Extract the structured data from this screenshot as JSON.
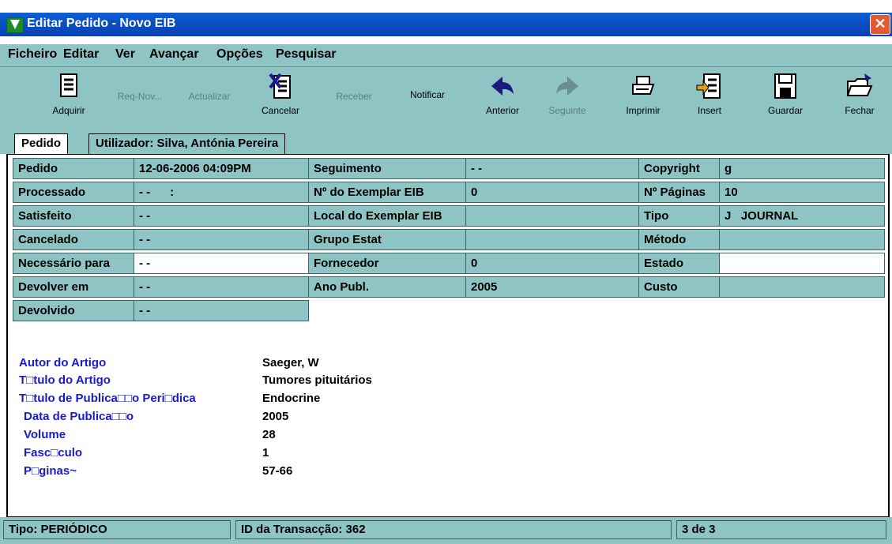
{
  "window": {
    "title": "Editar Pedido - Novo EIB",
    "close_glyph": "✕"
  },
  "menu": [
    {
      "label": "Ficheiro"
    },
    {
      "label": "Editar"
    },
    {
      "label": "Ver"
    },
    {
      "label": "Avançar"
    },
    {
      "label": "Opções"
    },
    {
      "label": "Pesquisar"
    }
  ],
  "toolbar": {
    "adquirir": "Adquirir",
    "req_nov": "Req-Nov...",
    "actualizar": "Actualizar",
    "cancelar": "Cancelar",
    "receber": "Receber",
    "notificar": "Notificar",
    "anterior": "Anterior",
    "seguinte": "Seguinte",
    "imprimir": "Imprimir",
    "insert": "Insert",
    "guardar": "Guardar",
    "fechar": "Fechar"
  },
  "tabs": {
    "pedido": "Pedido",
    "utilizador": "Utilizador: Silva, Antónia Pereira"
  },
  "fields": {
    "pedido_label": "Pedido",
    "pedido_value": "12-06-2006 04:09PM",
    "processado_label": "Processado",
    "processado_value": "- -      :",
    "satisfeito_label": "Satisfeito",
    "satisfeito_value": "- -",
    "cancelado_label": "Cancelado",
    "cancelado_value": "- -",
    "necessario_label": "Necessário para",
    "necessario_value": "- -",
    "devolver_label": "Devolver em",
    "devolver_value": "- -",
    "devolvido_label": "Devolvido",
    "devolvido_value": "- -",
    "seguimento_label": "Seguimento",
    "seguimento_value": "- -",
    "n_exemplar_label": "Nº do Exemplar EIB",
    "n_exemplar_value": "0",
    "local_exemplar_label": "Local do Exemplar EIB",
    "local_exemplar_value": "",
    "grupo_estat_label": "Grupo Estat",
    "grupo_estat_value": "",
    "fornecedor_label": "Fornecedor",
    "fornecedor_value": "0",
    "ano_publ_label": "Ano Publ.",
    "ano_publ_value": "2005",
    "copyright_label": "Copyright",
    "copyright_value": "g",
    "n_paginas_label": "Nº Páginas",
    "n_paginas_value": "10",
    "tipo_label": "Tipo",
    "tipo_value": "J   JOURNAL",
    "metodo_label": "Método",
    "metodo_value": "",
    "estado_label": "Estado",
    "estado_value": "",
    "custo_label": "Custo",
    "custo_value": ""
  },
  "article": [
    {
      "label": "Autor do Artigo",
      "value": "Saeger, W"
    },
    {
      "label": "T□tulo do Artigo",
      "value": "Tumores pituitários"
    },
    {
      "label": "T□tulo de Publica□□o Peri□dica",
      "value": "Endocrine"
    },
    {
      "label": "Data de Publica□□o",
      "value": "2005"
    },
    {
      "label": "Volume",
      "value": "28"
    },
    {
      "label": "Fasc□culo",
      "value": "1"
    },
    {
      "label": "P□ginas~",
      "value": "57-66"
    }
  ],
  "status": {
    "tipo": "Tipo: PERIÓDICO",
    "transaccao": "ID da Transacção: 362",
    "pagina": "3 de 3"
  },
  "colors": {
    "panel": "#8fc4c4",
    "title_bar": "#0a4fc4",
    "label_blue": "#1a1acc"
  }
}
